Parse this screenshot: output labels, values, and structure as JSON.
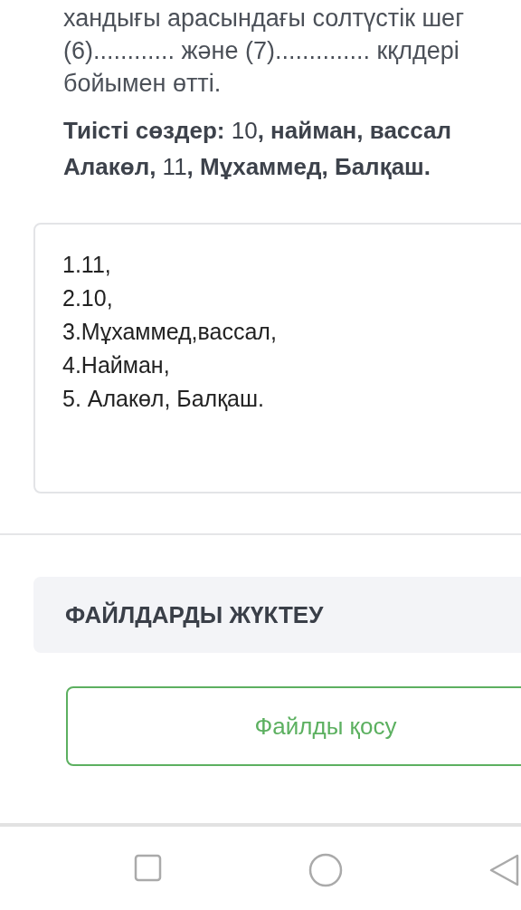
{
  "question": {
    "lines": [
      "хандығы арасындағы солтүстік шег",
      "(6)............ және (7).............. кқлдері",
      "бойымен өтті."
    ],
    "hint_lines": [
      "**Тиісті сөздер:** 10**, найман, вассал**",
      "**Алакөл,** 11**, Мұхаммед, Балқаш.**"
    ]
  },
  "answer": {
    "lines": [
      "1.11,",
      "2.10,",
      "3.Мұхаммед,вассал,",
      "4.Найман,",
      "5. Алакөл, Балқаш."
    ]
  },
  "upload": {
    "title": "ФАЙЛДАРДЫ ЖҮКТЕУ",
    "button": "Файлды қосу"
  }
}
